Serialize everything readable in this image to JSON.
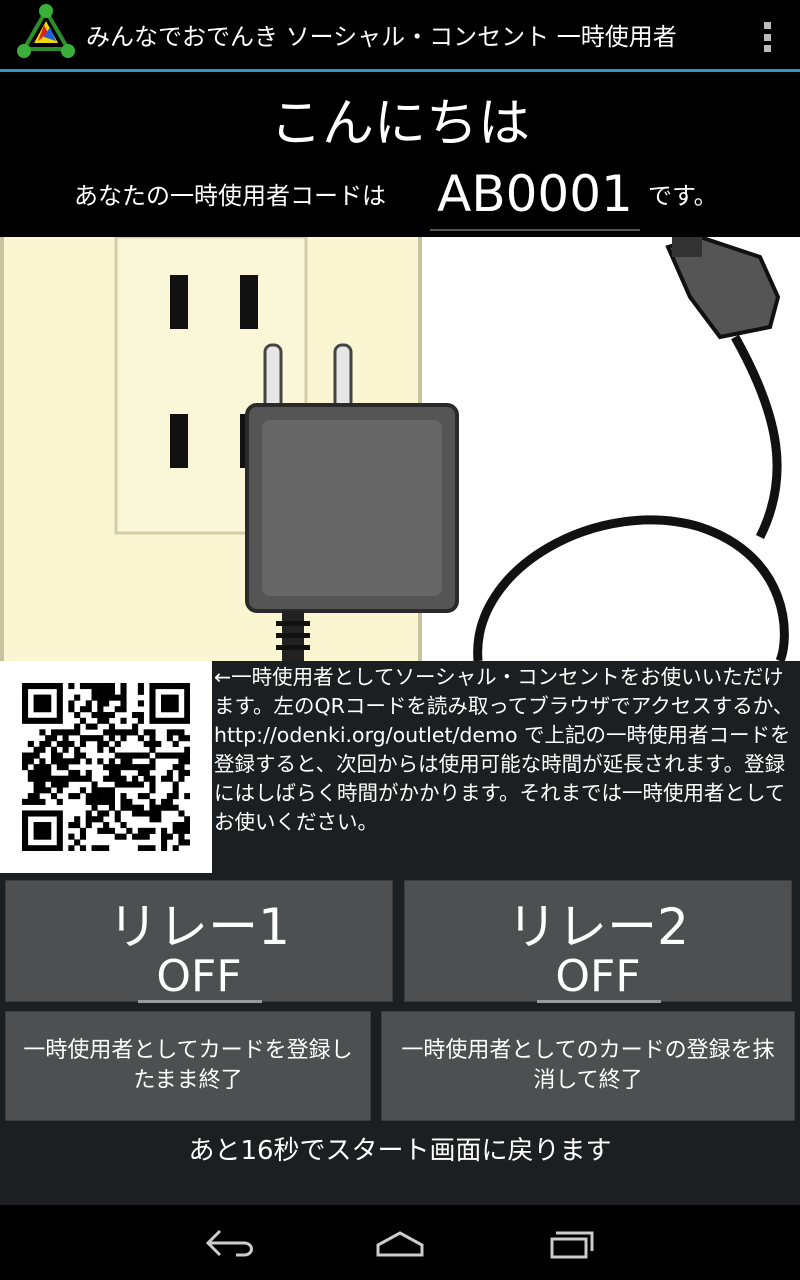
{
  "app": {
    "title": "みんなでおでんき ソーシャル・コンセント 一時使用者"
  },
  "greeting": {
    "hello": "こんにちは",
    "code_prefix": "あなたの一時使用者コードは",
    "code": "AB0001",
    "code_suffix": "です。"
  },
  "info": {
    "text": "←一時使用者としてソーシャル・コンセントをお使いいただけます。左のQRコードを読み取ってブラウザでアクセスするか、http://odenki.org/outlet/demo で上記の一時使用者コードを登録すると、次回からは使用可能な時間が延長されます。登録にはしばらく時間がかかります。それまでは一時使用者としてお使いください。"
  },
  "relays": [
    {
      "label": "リレー1",
      "state": "OFF"
    },
    {
      "label": "リレー2",
      "state": "OFF"
    }
  ],
  "actions": {
    "keep": "一時使用者としてカードを登録したまま終了",
    "erase": "一時使用者としてのカードの登録を抹消して終了"
  },
  "countdown": "あと16秒でスタート画面に戻ります",
  "colors": {
    "accent": "#2f96c8",
    "button": "#4d4f51",
    "panel": "#1c1f22"
  },
  "icons": {
    "app": "odenki-logo-icon",
    "menu": "overflow-menu-icon",
    "back": "back-icon",
    "home": "home-icon",
    "recents": "recents-icon"
  }
}
